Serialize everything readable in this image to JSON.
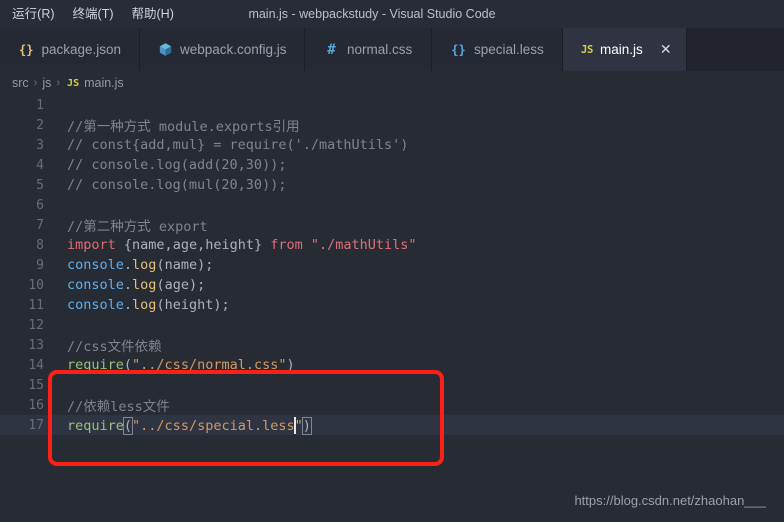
{
  "window": {
    "title": "main.js - webpackstudy - Visual Studio Code"
  },
  "menu": {
    "items": [
      {
        "label": ")",
        "name": "menu-item-clipped"
      },
      {
        "label": "运行(R)",
        "name": "menu-item-run"
      },
      {
        "label": "终端(T)",
        "name": "menu-item-terminal"
      },
      {
        "label": "帮助(H)",
        "name": "menu-item-help"
      }
    ]
  },
  "tabs": [
    {
      "label": "package.json",
      "icon": "json-braces-icon",
      "icon_text": "{}",
      "active": false
    },
    {
      "label": "webpack.config.js",
      "icon": "webpack-cube-icon",
      "icon_text": "",
      "active": false
    },
    {
      "label": "normal.css",
      "icon": "hash-icon",
      "icon_text": "#",
      "active": false
    },
    {
      "label": "special.less",
      "icon": "less-braces-icon",
      "icon_text": "{}",
      "active": false
    },
    {
      "label": "main.js",
      "icon": "js-icon",
      "icon_text": "JS",
      "active": true,
      "close_label": "✕"
    }
  ],
  "breadcrumb": {
    "items": [
      "src",
      "js",
      "main.js"
    ],
    "separator": "›",
    "file_icon_text": "JS"
  },
  "editor": {
    "active_line": 17,
    "cursor_line": 17,
    "lines": [
      {
        "n": "1",
        "text": ""
      },
      {
        "n": "2",
        "text": "//第一种方式 module.exports引用"
      },
      {
        "n": "3",
        "text": "// const{add,mul} = require('./mathUtils')"
      },
      {
        "n": "4",
        "text": "// console.log(add(20,30));"
      },
      {
        "n": "5",
        "text": "// console.log(mul(20,30));"
      },
      {
        "n": "6",
        "text": ""
      },
      {
        "n": "7",
        "text": "//第二种方式 export"
      },
      {
        "n": "8",
        "text": "import {name,age,height} from \"./mathUtils\""
      },
      {
        "n": "9",
        "text": "console.log(name);"
      },
      {
        "n": "10",
        "text": "console.log(age);"
      },
      {
        "n": "11",
        "text": "console.log(height);"
      },
      {
        "n": "12",
        "text": ""
      },
      {
        "n": "13",
        "text": "//css文件依赖"
      },
      {
        "n": "14",
        "text": "require(\"../css/normal.css\")"
      },
      {
        "n": "15",
        "text": ""
      },
      {
        "n": "16",
        "text": "//依赖less文件"
      },
      {
        "n": "17",
        "text": "require(\"../css/special.less\")"
      }
    ],
    "tokens": {
      "l2": [
        {
          "t": "//第一种方式 module.exports引用",
          "c": "cmt"
        }
      ],
      "l3": [
        {
          "t": "// const{add,mul} = require('./mathUtils')",
          "c": "cmt"
        }
      ],
      "l4": [
        {
          "t": "// console.log(add(20,30));",
          "c": "cmt"
        }
      ],
      "l5": [
        {
          "t": "// console.log(mul(20,30));",
          "c": "cmt"
        }
      ],
      "l7": [
        {
          "t": "//第二种方式 export",
          "c": "cmt"
        }
      ],
      "l8": [
        {
          "t": "import",
          "c": "kw"
        },
        {
          "t": " ",
          "c": "pun"
        },
        {
          "t": "{name,age,height}",
          "c": "var"
        },
        {
          "t": " ",
          "c": "pun"
        },
        {
          "t": "from",
          "c": "kw"
        },
        {
          "t": " ",
          "c": "pun"
        },
        {
          "t": "\"./mathUtils\"",
          "c": "str"
        }
      ],
      "l9": [
        {
          "t": "console",
          "c": "obj"
        },
        {
          "t": ".",
          "c": "pun"
        },
        {
          "t": "log",
          "c": "fn"
        },
        {
          "t": "(name);",
          "c": "pun"
        }
      ],
      "l10": [
        {
          "t": "console",
          "c": "obj"
        },
        {
          "t": ".",
          "c": "pun"
        },
        {
          "t": "log",
          "c": "fn"
        },
        {
          "t": "(age);",
          "c": "pun"
        }
      ],
      "l11": [
        {
          "t": "console",
          "c": "obj"
        },
        {
          "t": ".",
          "c": "pun"
        },
        {
          "t": "log",
          "c": "fn"
        },
        {
          "t": "(height);",
          "c": "pun"
        }
      ],
      "l13": [
        {
          "t": "//css文件依赖",
          "c": "cmt"
        }
      ],
      "l14": [
        {
          "t": "require",
          "c": "grn"
        },
        {
          "t": "(",
          "c": "pun"
        },
        {
          "t": "\"../css/normal.css\"",
          "c": "str2"
        },
        {
          "t": ")",
          "c": "pun"
        }
      ],
      "l16": [
        {
          "t": "//依赖less文件",
          "c": "cmt"
        }
      ],
      "l17": [
        {
          "t": "require",
          "c": "grn"
        },
        {
          "t": "(",
          "c": "brk"
        },
        {
          "t": "\"../css/special.less",
          "c": "str2"
        },
        {
          "t": "CARET",
          "c": "caret"
        },
        {
          "t": "\"",
          "c": "str2"
        },
        {
          "t": ")",
          "c": "brk"
        }
      ]
    }
  },
  "annotation": {
    "color": "#fc2018",
    "covers_lines": "15-17"
  },
  "watermark": {
    "text": "https://blog.csdn.net/zhaohan___"
  },
  "colors": {
    "titlebar_bg": "#272c38",
    "tabbar_bg": "#21242c",
    "tab_bg": "#252933",
    "active_tab_bg": "#2f3342",
    "editor_bg": "#272b33",
    "active_line_bg": "#2f3442",
    "line_number": "#666e7d",
    "comment": "#7f848e",
    "keyword": "#e06c75",
    "string": "#d19a66",
    "function_green": "#98c379",
    "object_blue": "#61afef",
    "method_yellow": "#e5c07b",
    "annotation_red": "#fc2018"
  }
}
